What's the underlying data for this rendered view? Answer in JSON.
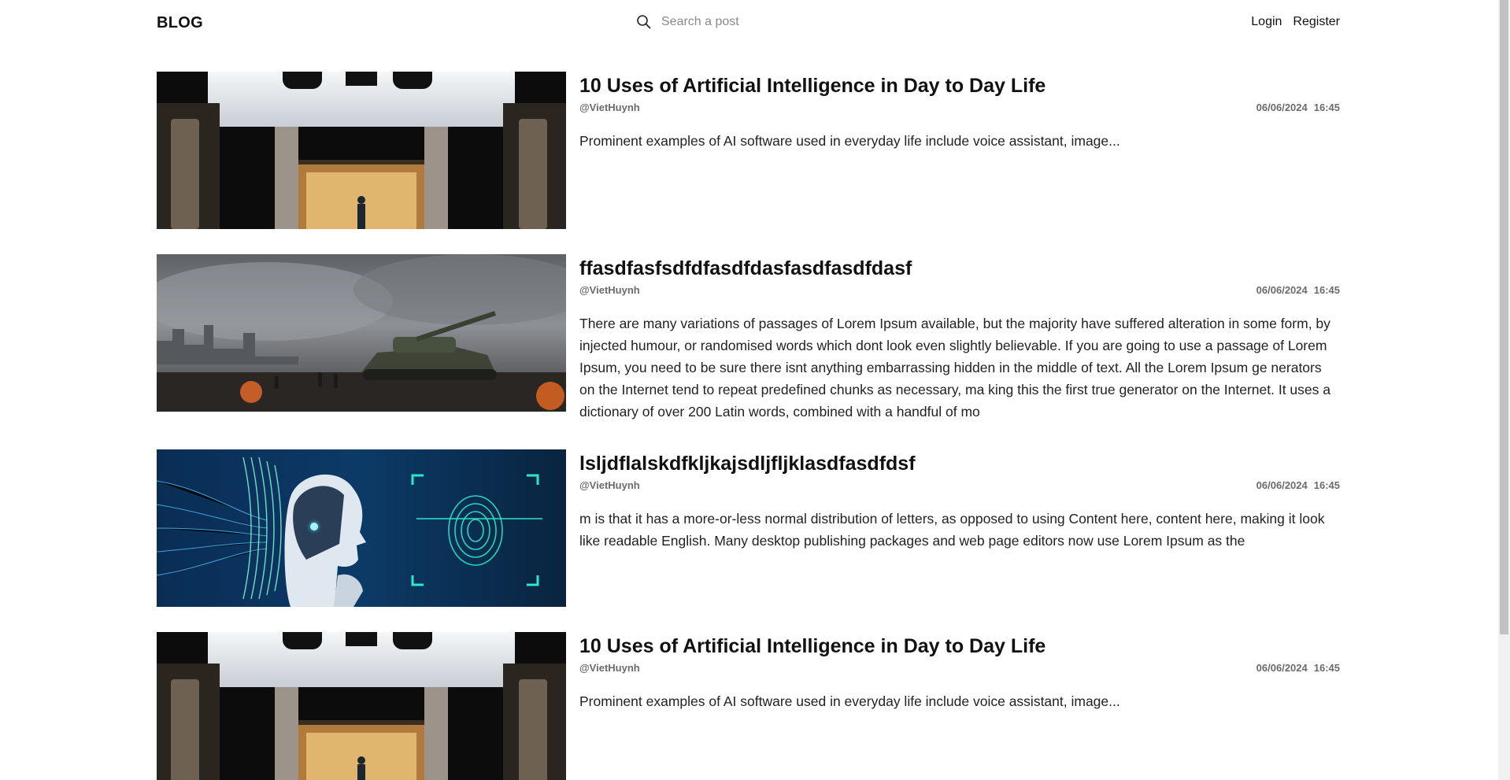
{
  "header": {
    "logo": "BLOG",
    "search": {
      "placeholder": "Search a post",
      "icon": "search-icon"
    },
    "login_label": "Login",
    "register_label": "Register"
  },
  "posts": [
    {
      "title": "10 Uses of Artificial Intelligence in Day to Day Life",
      "author": "@VietHuynh",
      "date": "06/06/2024",
      "time": "16:45",
      "excerpt": "Prominent examples of AI software used in everyday life include voice assistant, image..."
    },
    {
      "title": "ffasdfasfsdfdfasdfdasfasdfasdfdasf",
      "author": "@VietHuynh",
      "date": "06/06/2024",
      "time": "16:45",
      "excerpt": "There are many variations of passages of Lorem Ipsum available, but the majority have suffered alteration in some form, by injected humour, or randomised words which dont look even slightly believable. If you are going to use a passage of Lorem Ipsum, you need to be sure there isnt anything embarrassing hidden in the middle of text. All the Lorem Ipsum ge nerators on the Internet tend to repeat predefined chunks as necessary, ma king this the first true generator on the Internet. It uses a dictionary of over 200 Latin words, combined with a handful of mo"
    },
    {
      "title": "lsljdflalskdfkljkajsdljfljklasdfasdfdsf",
      "author": "@VietHuynh",
      "date": "06/06/2024",
      "time": "16:45",
      "excerpt": "m is that it has a more-or-less normal distribution of letters, as opposed to using Content here, content here, making it look like readable English. Many desktop publishing packages and web page editors now use Lorem Ipsum as the"
    },
    {
      "title": "10 Uses of Artificial Intelligence in Day to Day Life",
      "author": "@VietHuynh",
      "date": "06/06/2024",
      "time": "16:45",
      "excerpt": "Prominent examples of AI software used in everyday life include voice assistant, image..."
    }
  ]
}
